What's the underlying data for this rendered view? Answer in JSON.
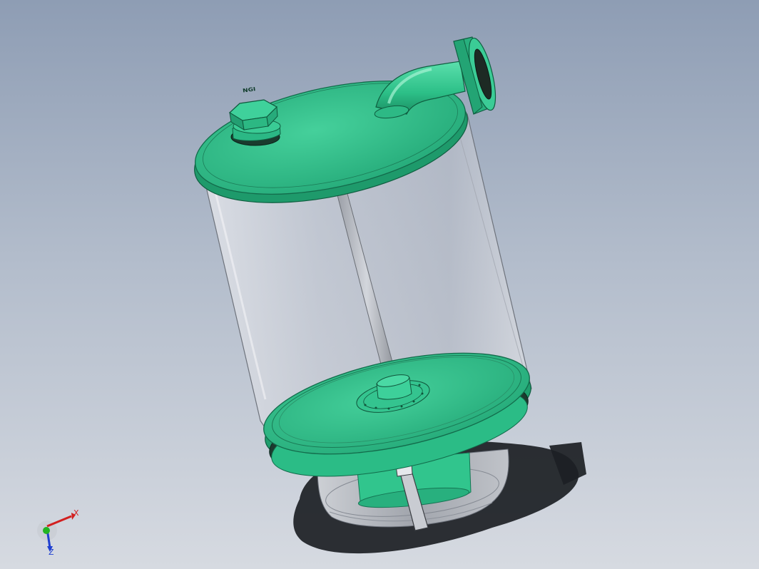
{
  "viewport": {
    "background_top": "#8e9db4",
    "background_bottom": "#d6dae1"
  },
  "model": {
    "part_color": "#2fc28b",
    "glass_color": "#c9ccd4",
    "plug_marking": "NGI"
  },
  "triad": {
    "x_label": "X",
    "z_label": "Z",
    "x_color": "#d22020",
    "z_color": "#2040d0",
    "y_color": "#22b422"
  }
}
